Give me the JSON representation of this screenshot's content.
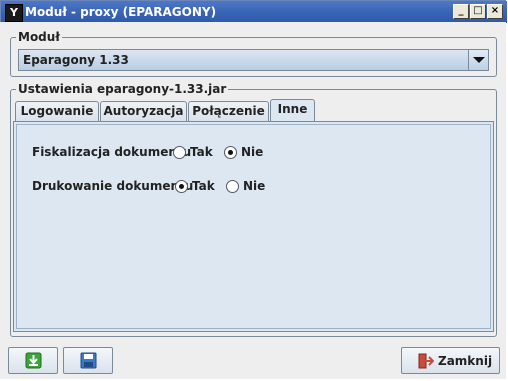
{
  "window": {
    "title": "Moduł - proxy (EPARAGONY)",
    "app_icon_text": "Y",
    "controls": {
      "minimize": "_",
      "maximize": "□",
      "close": "×"
    }
  },
  "module_group": {
    "label": "Moduł",
    "selected_module": "Eparagony 1.33"
  },
  "settings_group": {
    "label": "Ustawienia eparagony-1.33.jar",
    "tabs": [
      {
        "label": "Logowanie",
        "active": false
      },
      {
        "label": "Autoryzacja",
        "active": false
      },
      {
        "label": "Połączenie",
        "active": false
      },
      {
        "label": "Inne",
        "active": true
      }
    ],
    "inne": {
      "fiskalizacja": {
        "label": "Fiskalizacja dokumentu",
        "options": [
          {
            "label": "Tak",
            "selected": false
          },
          {
            "label": "Nie",
            "selected": true
          }
        ]
      },
      "drukowanie": {
        "label": "Drukowanie dokumentu",
        "options": [
          {
            "label": "Tak",
            "selected": true
          },
          {
            "label": "Nie",
            "selected": false
          }
        ]
      }
    }
  },
  "footer": {
    "download_icon": "download-arrow-icon",
    "save_icon": "floppy-disk-icon",
    "close_button_label": "Zamknij",
    "close_icon": "exit-door-icon"
  }
}
